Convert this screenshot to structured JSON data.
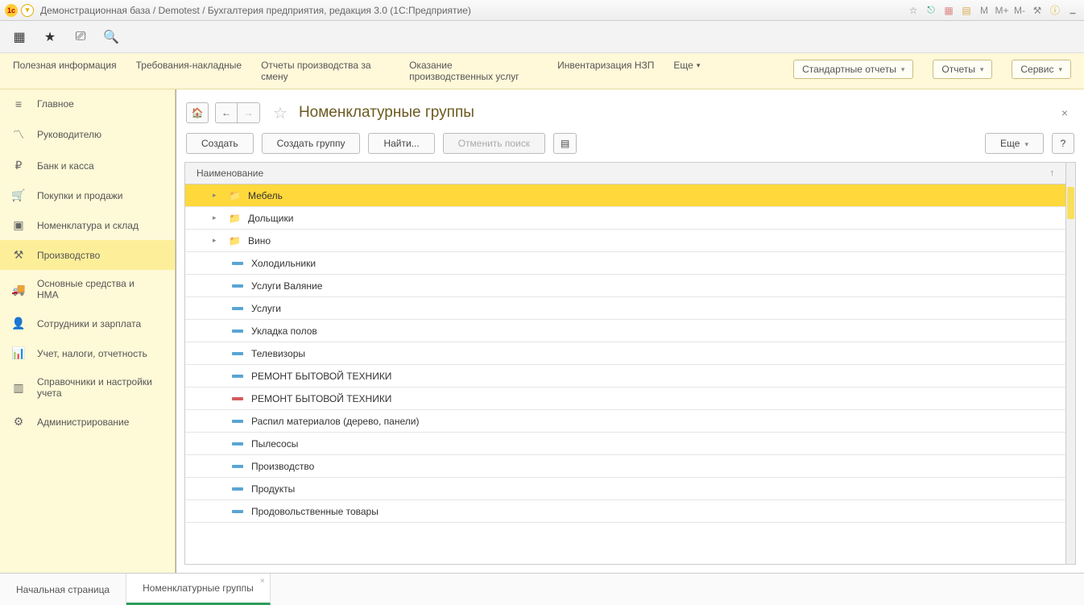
{
  "titlebar": {
    "title": "Демонстрационная база / Demotest / Бухгалтерия предприятия, редакция 3.0  (1С:Предприятие)",
    "m1": "M",
    "m2": "M+",
    "m3": "M-"
  },
  "cmdbar": {
    "c1": "Полезная информация",
    "c2": "Требования-накладные",
    "c3": "Отчеты производства за смену",
    "c4": "Оказание производственных услуг",
    "c5": "Инвентаризация НЗП",
    "more": "Еще",
    "b1": "Стандартные отчеты",
    "b2": "Отчеты",
    "b3": "Сервис"
  },
  "sidebar": {
    "items": {
      "0": {
        "label": "Главное"
      },
      "1": {
        "label": "Руководителю"
      },
      "2": {
        "label": "Банк и касса"
      },
      "3": {
        "label": "Покупки и продажи"
      },
      "4": {
        "label": "Номенклатура и склад"
      },
      "5": {
        "label": "Производство"
      },
      "6": {
        "label": "Основные средства и НМА"
      },
      "7": {
        "label": "Сотрудники и зарплата"
      },
      "8": {
        "label": "Учет, налоги, отчетность"
      },
      "9": {
        "label": "Справочники и настройки учета"
      },
      "10": {
        "label": "Администрирование"
      }
    }
  },
  "page": {
    "title": "Номенклатурные группы",
    "close": "×"
  },
  "actions": {
    "create": "Создать",
    "create_group": "Создать группу",
    "find": "Найти...",
    "cancel_search": "Отменить поиск",
    "more": "Еще",
    "help": "?"
  },
  "table": {
    "header": "Наименование",
    "sort": "↑",
    "rows": {
      "0": {
        "label": "Мебель"
      },
      "1": {
        "label": "Дольщики"
      },
      "2": {
        "label": "Вино"
      },
      "3": {
        "label": "Холодильники"
      },
      "4": {
        "label": "Услуги Валяние"
      },
      "5": {
        "label": "Услуги"
      },
      "6": {
        "label": "Укладка полов"
      },
      "7": {
        "label": "Телевизоры"
      },
      "8": {
        "label": "РЕМОНТ БЫТОВОЙ ТЕХНИКИ"
      },
      "9": {
        "label": "РЕМОНТ БЫТОВОЙ ТЕХНИКИ"
      },
      "10": {
        "label": "Распил материалов (дерево, панели)"
      },
      "11": {
        "label": "Пылесосы"
      },
      "12": {
        "label": "Производство"
      },
      "13": {
        "label": "Продукты"
      },
      "14": {
        "label": "Продовольственные товары"
      }
    }
  },
  "tabs": {
    "t1": "Начальная страница",
    "t2": "Номенклатурные группы"
  }
}
